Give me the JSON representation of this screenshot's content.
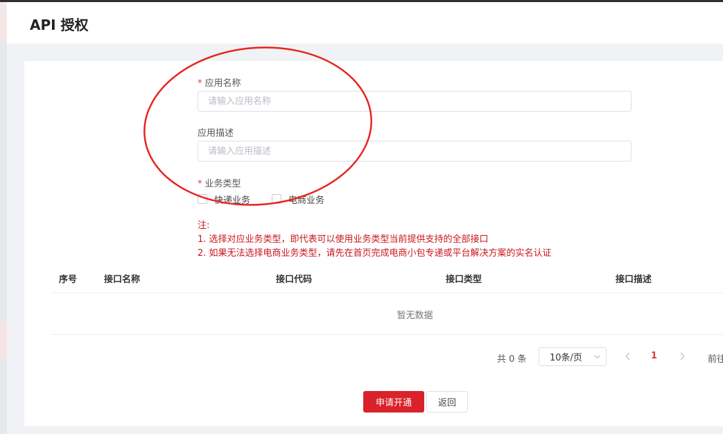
{
  "page": {
    "title": "API 授权"
  },
  "form": {
    "app_name": {
      "label": "应用名称",
      "required_mark": "*",
      "placeholder": "请输入应用名称",
      "value": ""
    },
    "app_desc": {
      "label": "应用描述",
      "placeholder": "请输入应用描述",
      "value": ""
    },
    "biz_type": {
      "label": "业务类型",
      "required_mark": "*",
      "options": [
        {
          "label": "快递业务",
          "checked": false
        },
        {
          "label": "电商业务",
          "checked": false
        }
      ]
    }
  },
  "note": {
    "title": "注:",
    "line1": "1. 选择对应业务类型，即代表可以使用业务类型当前提供支持的全部接口",
    "line2": "2. 如果无法选择电商业务类型，请先在首页完成电商小包专递或平台解决方案的实名认证"
  },
  "table": {
    "columns": [
      "序号",
      "接口名称",
      "接口代码",
      "接口类型",
      "接口描述"
    ],
    "rows": [],
    "empty_text": "暂无数据"
  },
  "pagination": {
    "total_text": "共 0 条",
    "page_size": "10条/页",
    "current_page": "1",
    "goto_text": "前往"
  },
  "actions": {
    "apply_label": "申请开通",
    "back_label": "返回"
  },
  "colors": {
    "accent": "#d9222a",
    "annotation": "#e8231f",
    "required": "#e4393c"
  }
}
